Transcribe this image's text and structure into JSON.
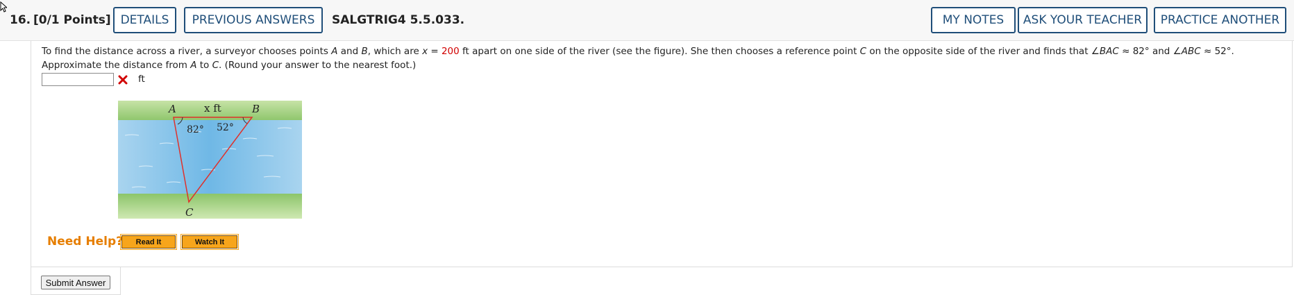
{
  "header": {
    "question_number": "16.",
    "points": "[0/1 Points]",
    "details_label": "DETAILS",
    "previous_answers_label": "PREVIOUS ANSWERS",
    "question_code": "SALGTRIG4 5.5.033.",
    "my_notes_label": "MY NOTES",
    "ask_teacher_label": "ASK YOUR TEACHER",
    "practice_another_label": "PRACTICE ANOTHER"
  },
  "question": {
    "text_part1": "To find the distance across a river, a surveyor chooses points ",
    "point_a": "A",
    "text_and": " and ",
    "point_b": "B",
    "text_part2": ", which are ",
    "var_x": "x",
    "text_eq": " = ",
    "x_value": "200",
    "text_part3": " ft apart on one side of the river (see the figure). She then chooses a reference point ",
    "point_c": "C",
    "text_part4": " on the opposite side of the river and finds that ∠",
    "angle_bac": "BAC",
    "text_part5": " ≈ 82° and ∠",
    "angle_abc": "ABC",
    "text_part6": " ≈ 52°. Approximate the distance from ",
    "point_a2": "A",
    "text_to": " to ",
    "point_c2": "C",
    "text_part7": ". (Round your answer to the nearest foot.)"
  },
  "answer": {
    "value": "",
    "status": "incorrect",
    "unit": "ft"
  },
  "figure": {
    "label_a": "A",
    "label_b": "B",
    "label_c": "C",
    "label_x": "x ft",
    "angle_a": "82°",
    "angle_b": "52°"
  },
  "help": {
    "title": "Need Help?",
    "read_it_label": "Read It",
    "watch_it_label": "Watch It"
  },
  "submit_label": "Submit Answer",
  "colors": {
    "accent": "#1f4e79",
    "error": "#d10000",
    "help": "#e67e00",
    "help_button": "#f7a51b"
  }
}
